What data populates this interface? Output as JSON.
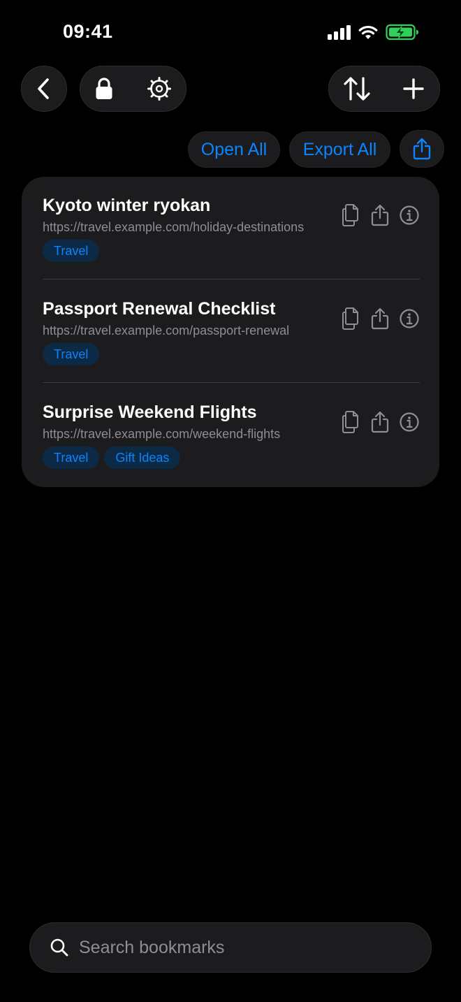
{
  "status_bar": {
    "time": "09:41",
    "icons": [
      "cellular-signal-icon",
      "wifi-icon",
      "battery-charging-icon"
    ]
  },
  "header": {
    "left_icons": [
      "back-chevron-icon",
      "lock-icon",
      "gear-icon"
    ],
    "right_icons": [
      "sort-arrows-icon",
      "plus-icon"
    ]
  },
  "actions": {
    "open_all": "Open All",
    "export_all": "Export All",
    "share_icon": "share-icon"
  },
  "bookmarks": [
    {
      "title": "Kyoto winter ryokan",
      "url": "https://travel.example.com/holiday-destinations",
      "tags": [
        "Travel"
      ]
    },
    {
      "title": "Passport Renewal Checklist",
      "url": "https://travel.example.com/passport-renewal",
      "tags": [
        "Travel"
      ]
    },
    {
      "title": "Surprise Weekend Flights",
      "url": "https://travel.example.com/weekend-flights",
      "tags": [
        "Travel",
        "Gift Ideas"
      ]
    }
  ],
  "row_icons": [
    "copy-icon",
    "share-icon",
    "info-icon"
  ],
  "search": {
    "placeholder": "Search bookmarks",
    "value": ""
  },
  "colors": {
    "accent": "#0a84ff",
    "background": "#000000",
    "surface": "#1c1c1e",
    "secondary_text": "#8e8e93",
    "battery": "#30d158"
  }
}
